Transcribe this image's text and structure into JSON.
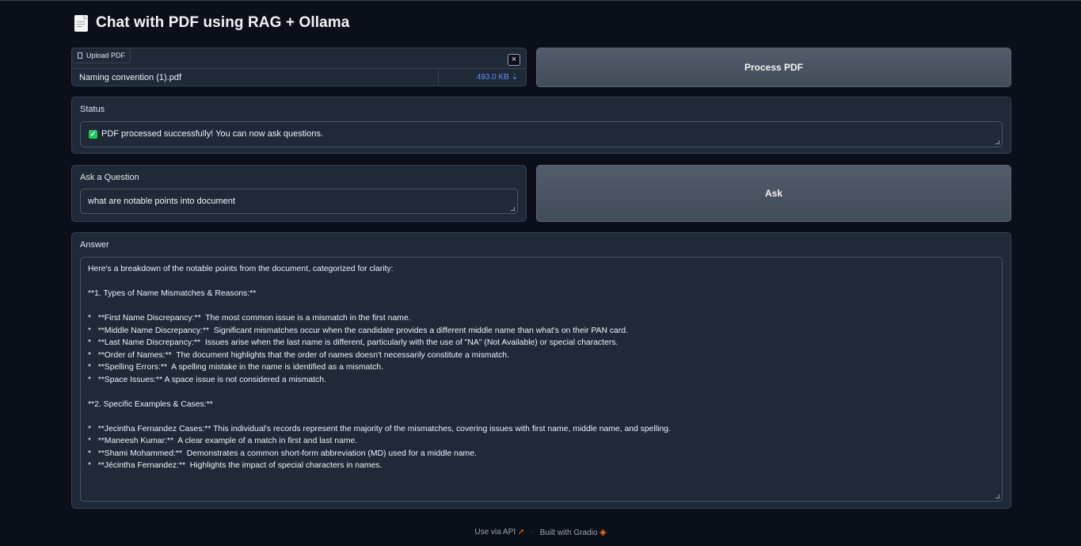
{
  "header": {
    "title": "Chat with PDF using RAG + Ollama"
  },
  "upload": {
    "tab_label": "Upload PDF",
    "close": "×",
    "file_name": "Naming convention (1).pdf",
    "file_size": "493.0 KB ⇣"
  },
  "process_button": "Process PDF",
  "status": {
    "label": "Status",
    "check": "✓",
    "value": "PDF processed successfully! You can now ask questions."
  },
  "question": {
    "label": "Ask a Question",
    "value": "what are notable points into document"
  },
  "ask_button": "Ask",
  "answer": {
    "label": "Answer",
    "lines": [
      "Here's a breakdown of the notable points from the document, categorized for clarity:",
      "",
      "**1. Types of Name Mismatches & Reasons:**",
      "",
      "*   **First Name Discrepancy:**  The most common issue is a mismatch in the first name.",
      "*   **Middle Name Discrepancy:**  Significant mismatches occur when the candidate provides a different middle name than what's on their PAN card.",
      "*   **Last Name Discrepancy:**  Issues arise when the last name is different, particularly with the use of \"NA\" (Not Available) or special characters.",
      "*   **Order of Names:**  The document highlights that the order of names doesn't necessarily constitute a mismatch.",
      "*   **Spelling Errors:**  A spelling mistake in the name is identified as a mismatch.",
      "*   **Space Issues:** A space issue is not considered a mismatch.",
      "",
      "**2. Specific Examples & Cases:**",
      "",
      "*   **Jecintha Fernandez Cases:** This individual's records represent the majority of the mismatches, covering issues with first name, middle name, and spelling.",
      "*   **Maneesh Kumar:**  A clear example of a match in first and last name.",
      "*   **Shami Mohammed:**  Demonstrates a common short-form abbreviation (MD) used for a middle name.",
      "*   **Jécintha Fernandez:**  Highlights the impact of special characters in names."
    ]
  },
  "footer": {
    "api_link": "Use via API",
    "separator": "·",
    "built_with": "Built with Gradio"
  }
}
